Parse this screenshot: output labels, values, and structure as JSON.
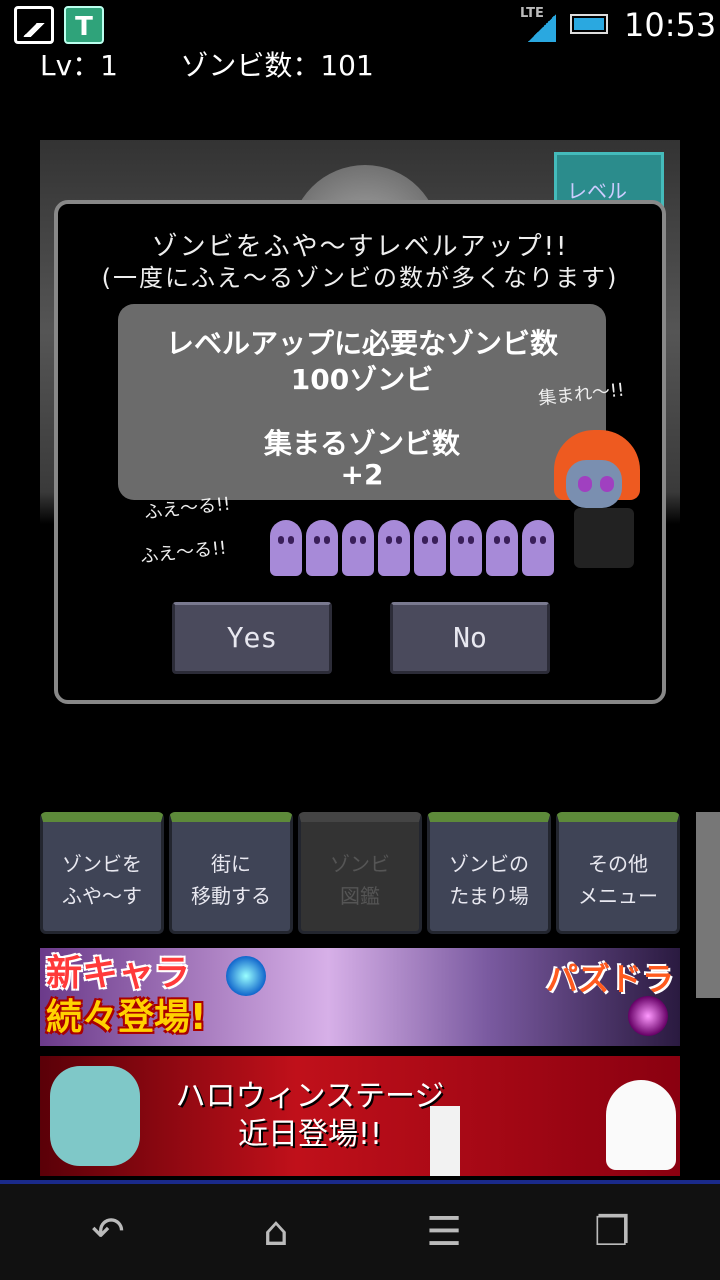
{
  "status_bar": {
    "network": "LTE",
    "time": "10:53",
    "icons": [
      "gallery-icon",
      "t-app-icon",
      "signal-icon",
      "battery-icon"
    ]
  },
  "stats": {
    "level_text": "Lv：1",
    "zombie_count_text": "ゾンビ数：101"
  },
  "scene": {
    "level_button_label": "レベル"
  },
  "dialog": {
    "title_line1": "ゾンビをふや〜すレベルアップ!!",
    "title_line2": "(一度にふえ〜るゾンビの数が多くなります)",
    "required_label": "レベルアップに必要なゾンビ数",
    "required_value": "100ゾンビ",
    "gather_label": "集まるゾンビ数",
    "gather_value": "+2",
    "shout_gather": "集まれ〜!!",
    "shout_increase_1": "ふえ〜る!!",
    "shout_increase_2": "ふえ〜る!!",
    "yes_label": "Yes",
    "no_label": "No"
  },
  "menu": {
    "tiles": [
      {
        "line1": "ゾンビを",
        "line2": "ふや〜す",
        "enabled": true
      },
      {
        "line1": "街に",
        "line2": "移動する",
        "enabled": true
      },
      {
        "line1": "ゾンビ",
        "line2": "図鑑",
        "enabled": false
      },
      {
        "line1": "ゾンビの",
        "line2": "たまり場",
        "enabled": true
      },
      {
        "line1": "その他",
        "line2": "メニュー",
        "enabled": true
      }
    ]
  },
  "banners": {
    "ad1_line1": "新キャラ",
    "ad1_line2": "続々登場!",
    "ad1_brand": "パズドラ",
    "ad2_line1": "ハロウィンステージ",
    "ad2_line2": "近日登場!!"
  },
  "navbar": {
    "back": "↶",
    "home": "⌂",
    "menu": "☰",
    "recent": "❐"
  }
}
